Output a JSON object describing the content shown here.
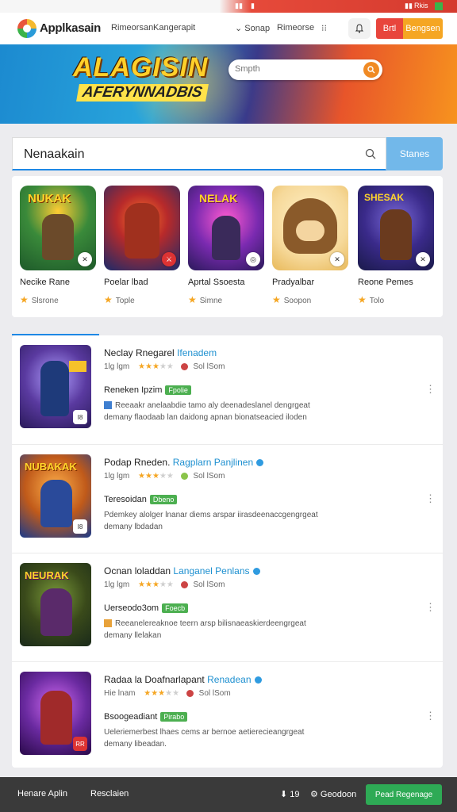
{
  "status_strip": {
    "right_text": "Rkis"
  },
  "header": {
    "brand": "Applkasain",
    "nav": [
      "Rimeorsan",
      "Kangerapit",
      "Sonap",
      "Rimeorse"
    ],
    "btn_red": "Brtl",
    "btn_orange": "Bengsen"
  },
  "banner": {
    "title": "ALAGISIN",
    "subtitle": "AFERYNNADBIS",
    "search_placeholder": "Smpth"
  },
  "search": {
    "query": "Nenaakain",
    "button_label": "Stanes"
  },
  "featured": [
    {
      "name": "Necike Rane",
      "meta": "Slsrone"
    },
    {
      "name": "Poelar lbad",
      "meta": "Tople"
    },
    {
      "name": "Aprtal Ssoesta",
      "meta": "Simne"
    },
    {
      "name": "Pradyalbar",
      "meta": "Soopon"
    },
    {
      "name": "Reone Pemes",
      "meta": "Tolo"
    }
  ],
  "list": [
    {
      "title": "Neclay Rnegarel",
      "title_highlight": "Ifenadem",
      "rating": 3,
      "plays": "1lg lgm",
      "size": "Sol lSom",
      "subtitle": "Reneken Ipzim",
      "tag": "Fpolie",
      "desc1": "Reeaakr anelaabdie tamo aly deenadeslanel dengrgeat",
      "desc2": "demany flaodaab lan daidong apnan bionatseacied iloden",
      "verified": false,
      "thumb_badge": "I8"
    },
    {
      "title": "Podap Rneden.",
      "title_highlight": "Ragplarn Panjlinen",
      "rating": 3,
      "plays": "1lg lgm",
      "size": "Sol lSom",
      "subtitle": "Teresoidan",
      "tag": "Dbeno",
      "desc1": "Pdemkey alolger lnanar diems arspar iirasdeenaccgengrgeat",
      "desc2": "demany lbdadan",
      "verified": true,
      "thumb_badge": "I8"
    },
    {
      "title": "Ocnan loladdan",
      "title_highlight": "Langanel Penlans",
      "rating": 3,
      "plays": "1lg lgm",
      "size": "Sol lSom",
      "subtitle": "Uerseodo3om",
      "tag": "Foecb",
      "desc1": "Reeanelereaknoe teern arsp bilisnaeaskierdeengrgeat",
      "desc2": "demany llelakan",
      "verified": true,
      "thumb_badge": ""
    },
    {
      "title": "Radaa la Doafnarlapant",
      "title_highlight": "Renadean",
      "rating": 3,
      "plays": "Hie lnam",
      "size": "Sol lSom",
      "subtitle": "Bsoogeadiant",
      "tag": "Pirabo",
      "desc1": "Ueleriemerbest lhaes cems ar bernoe aetierecieangrgeat",
      "desc2": "demany libeadan.",
      "verified": true,
      "thumb_badge": "RR"
    }
  ],
  "bottom_bar": {
    "left": "Henare Aplin",
    "mid": "Resclaien",
    "count": "19",
    "settings": "Geodoon",
    "button": "Pead Regenage"
  },
  "colors": {
    "accent_blue": "#1e88e5",
    "brand_red": "#e8453c",
    "brand_orange": "#f5a623",
    "tag_green": "#4caf50",
    "bottom_btn_green": "#2eaa55"
  }
}
